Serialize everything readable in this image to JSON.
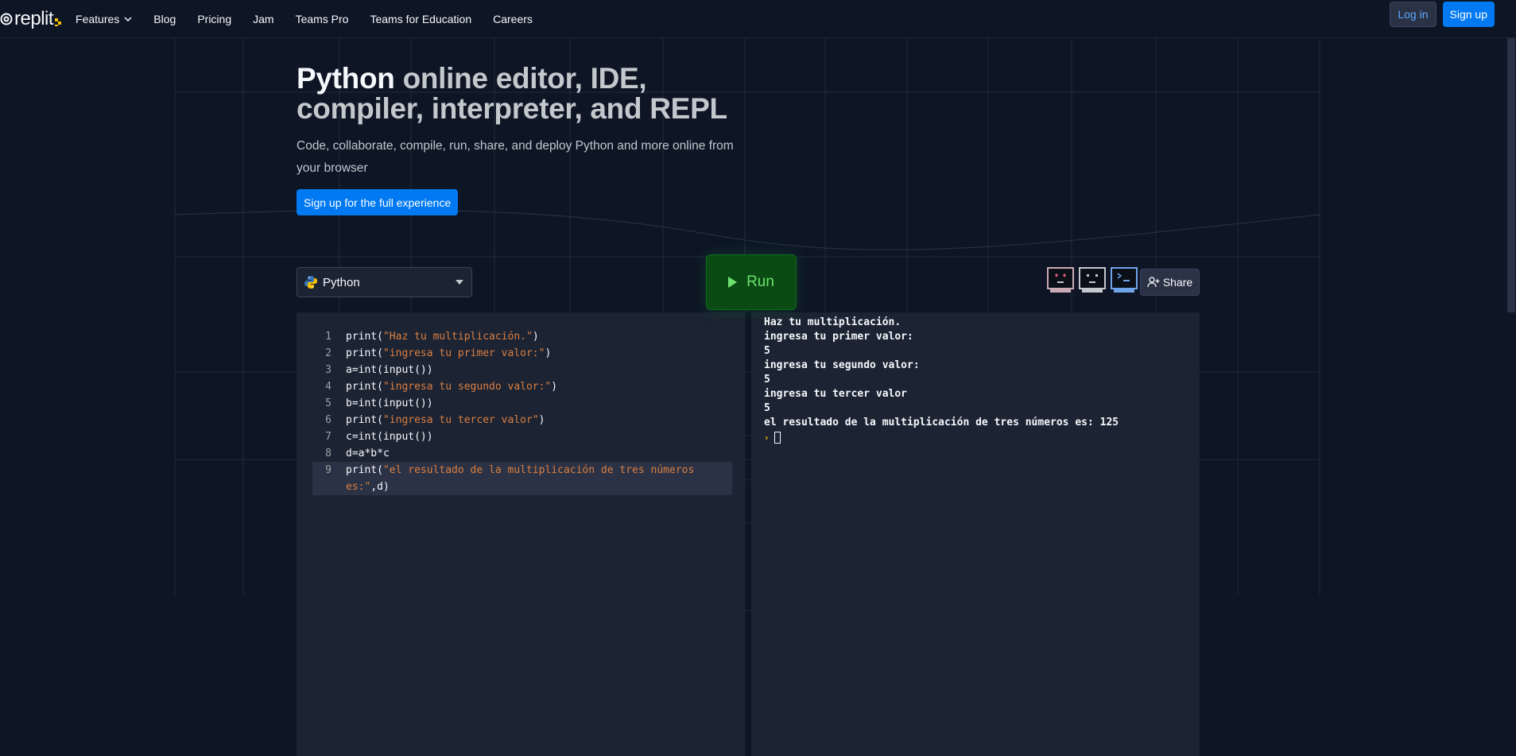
{
  "nav": {
    "logo_text": "replit",
    "links": [
      {
        "label": "Features",
        "has_dropdown": true
      },
      {
        "label": "Blog"
      },
      {
        "label": "Pricing"
      },
      {
        "label": "Jam"
      },
      {
        "label": "Teams Pro"
      },
      {
        "label": "Teams for Education"
      },
      {
        "label": "Careers"
      }
    ],
    "login_label": "Log in",
    "signup_label": "Sign up"
  },
  "hero": {
    "title_emphasis": "Python",
    "title_rest": " online editor, IDE, compiler, interpreter, and REPL",
    "subtitle": "Code, collaborate, compile, run, share, and deploy Python and more online from your browser",
    "cta_label": "Sign up for the full experience"
  },
  "toolbar": {
    "language": "Python",
    "run_label": "Run",
    "share_label": "Share"
  },
  "editor": {
    "lines": [
      {
        "num": "1",
        "parts": [
          {
            "t": "print(",
            "s": false
          },
          {
            "t": "\"Haz tu multiplicación.\"",
            "s": true
          },
          {
            "t": ")",
            "s": false
          }
        ]
      },
      {
        "num": "2",
        "parts": [
          {
            "t": "print(",
            "s": false
          },
          {
            "t": "\"ingresa tu primer valor:\"",
            "s": true
          },
          {
            "t": ")",
            "s": false
          }
        ]
      },
      {
        "num": "3",
        "parts": [
          {
            "t": "a=int(input())",
            "s": false
          }
        ]
      },
      {
        "num": "4",
        "parts": [
          {
            "t": "print(",
            "s": false
          },
          {
            "t": "\"ingresa tu segundo valor:\"",
            "s": true
          },
          {
            "t": ")",
            "s": false
          }
        ]
      },
      {
        "num": "5",
        "parts": [
          {
            "t": "b=int(input())",
            "s": false
          }
        ]
      },
      {
        "num": "6",
        "parts": [
          {
            "t": "print(",
            "s": false
          },
          {
            "t": "\"ingresa tu tercer valor\"",
            "s": true
          },
          {
            "t": ")",
            "s": false
          }
        ]
      },
      {
        "num": "7",
        "parts": [
          {
            "t": "c=int(input())",
            "s": false
          }
        ]
      },
      {
        "num": "8",
        "parts": [
          {
            "t": "d=a*b*c",
            "s": false
          }
        ]
      },
      {
        "num": "9",
        "parts": [
          {
            "t": "print(",
            "s": false
          },
          {
            "t": "\"el resultado de la multiplicación de tres números es:\"",
            "s": true
          },
          {
            "t": ",d)",
            "s": false
          }
        ],
        "active": true
      }
    ]
  },
  "console": {
    "output": [
      "Haz tu multiplicación.",
      "ingresa tu primer valor:",
      "5",
      "ingresa tu segundo valor:",
      "5",
      "ingresa tu tercer valor",
      "5",
      "el resultado de la multiplicación de tres números es: 125"
    ],
    "prompt_symbol": "›"
  },
  "colors": {
    "background": "#0e1525",
    "panel": "#1c2333",
    "accent_blue": "#0079f2",
    "run_green": "#6ee26f",
    "string_orange": "#db7f40"
  }
}
